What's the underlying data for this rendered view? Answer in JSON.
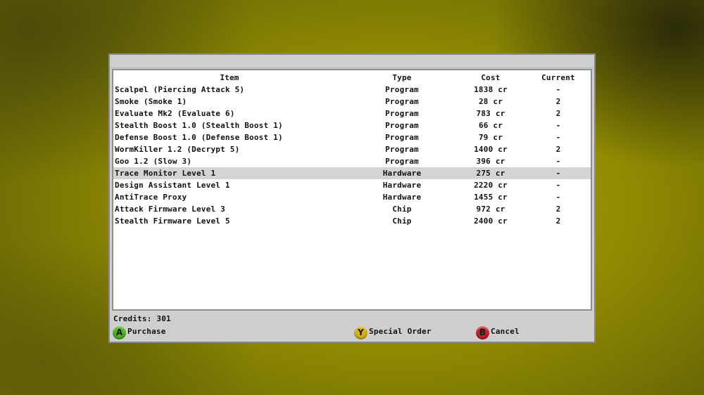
{
  "colors": {
    "a_button": "#52b322",
    "y_button": "#d7b21c",
    "b_button": "#c4202a",
    "selection": "#d4d4d4",
    "background": "#a9a301"
  },
  "table": {
    "headers": {
      "item": "Item",
      "type": "Type",
      "cost": "Cost",
      "current": "Current"
    },
    "selected_index": 7,
    "rows": [
      {
        "item": "Scalpel (Piercing Attack 5)",
        "type": "Program",
        "cost": "1838 cr",
        "current": "-"
      },
      {
        "item": "Smoke (Smoke 1)",
        "type": "Program",
        "cost": "28 cr",
        "current": "2"
      },
      {
        "item": "Evaluate Mk2 (Evaluate 6)",
        "type": "Program",
        "cost": "783 cr",
        "current": "2"
      },
      {
        "item": "Stealth Boost 1.0 (Stealth Boost 1)",
        "type": "Program",
        "cost": "66 cr",
        "current": "-"
      },
      {
        "item": "Defense Boost 1.0 (Defense Boost 1)",
        "type": "Program",
        "cost": "79 cr",
        "current": "-"
      },
      {
        "item": "WormKiller 1.2 (Decrypt 5)",
        "type": "Program",
        "cost": "1400 cr",
        "current": "2"
      },
      {
        "item": "Goo 1.2 (Slow 3)",
        "type": "Program",
        "cost": "396 cr",
        "current": "-"
      },
      {
        "item": "Trace Monitor Level 1",
        "type": "Hardware",
        "cost": "275 cr",
        "current": "-"
      },
      {
        "item": "Design Assistant Level 1",
        "type": "Hardware",
        "cost": "2220 cr",
        "current": "-"
      },
      {
        "item": "AntiTrace Proxy",
        "type": "Hardware",
        "cost": "1455 cr",
        "current": "-"
      },
      {
        "item": "Attack Firmware  Level 3",
        "type": "Chip",
        "cost": "972 cr",
        "current": "2"
      },
      {
        "item": "Stealth Firmware  Level 5",
        "type": "Chip",
        "cost": "2400 cr",
        "current": "2"
      }
    ]
  },
  "footer": {
    "credits": "Credits: 301",
    "buttons": [
      {
        "key": "A",
        "label": "Purchase",
        "icon": "a-button-icon"
      },
      {
        "key": "Y",
        "label": "Special Order",
        "icon": "y-button-icon"
      },
      {
        "key": "B",
        "label": "Cancel",
        "icon": "b-button-icon"
      }
    ]
  }
}
